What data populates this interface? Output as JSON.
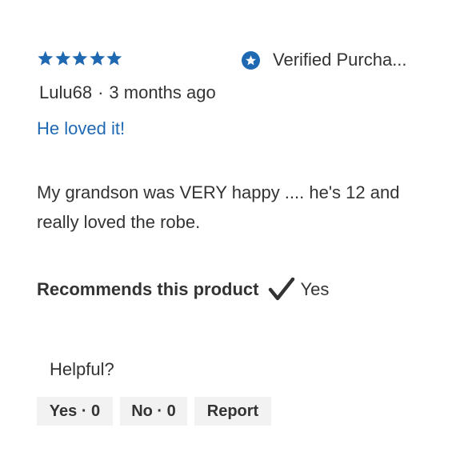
{
  "rating": {
    "stars": 5,
    "max_stars": 5,
    "star_color": "#1f69b3"
  },
  "verified": {
    "label": "Verified Purcha...",
    "icon": "star-badge-icon",
    "color": "#1f69b3"
  },
  "author": {
    "name": "Lulu68",
    "separator": "·",
    "time": "3 months ago"
  },
  "review": {
    "title": "He loved it!",
    "title_color": "#1f69b3",
    "body": "My grandson was VERY happy .... he's 12 and really loved the robe."
  },
  "recommends": {
    "label": "Recommends this product",
    "icon": "checkmark-icon",
    "value": "Yes"
  },
  "helpful": {
    "label": "Helpful?",
    "yes_button": "Yes · 0",
    "no_button": "No · 0",
    "report_button": "Report"
  }
}
